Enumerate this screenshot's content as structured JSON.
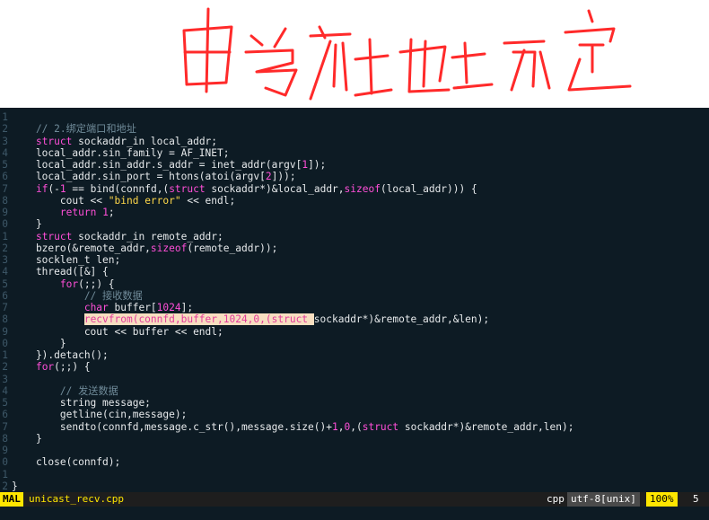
{
  "annotation": {
    "text": "由当前地址而定",
    "color": "#ff2a2a"
  },
  "editor": {
    "lines": [
      {
        "no": "1",
        "code": ""
      },
      {
        "no": "2",
        "code": "    // 2.绑定端口和地址"
      },
      {
        "no": "3",
        "code": "    struct sockaddr_in local_addr;"
      },
      {
        "no": "4",
        "code": "    local_addr.sin_family = AF_INET;"
      },
      {
        "no": "5",
        "code": "    local_addr.sin_addr.s_addr = inet_addr(argv[1]);"
      },
      {
        "no": "6",
        "code": "    local_addr.sin_port = htons(atoi(argv[2]));"
      },
      {
        "no": "7",
        "code": "    if(-1 == bind(connfd,(struct sockaddr*)&local_addr,sizeof(local_addr))) {"
      },
      {
        "no": "8",
        "code": "        cout << \"bind error\" << endl;"
      },
      {
        "no": "9",
        "code": "        return 1;"
      },
      {
        "no": "0",
        "code": "    }"
      },
      {
        "no": "1",
        "code": "    struct sockaddr_in remote_addr;"
      },
      {
        "no": "2",
        "code": "    bzero(&remote_addr,sizeof(remote_addr));"
      },
      {
        "no": "3",
        "code": "    socklen_t len;"
      },
      {
        "no": "4",
        "code": "    thread([&] {"
      },
      {
        "no": "5",
        "code": "        for(;;) {"
      },
      {
        "no": "6",
        "code": "            // 接收数据"
      },
      {
        "no": "7",
        "code": "            char buffer[1024];"
      },
      {
        "no": "8",
        "code": "            recvfrom(connfd,buffer,1024,0,(struct sockaddr*)&remote_addr,&len);"
      },
      {
        "no": "9",
        "code": "            cout << buffer << endl;"
      },
      {
        "no": "0",
        "code": "        }"
      },
      {
        "no": "1",
        "code": "    }).detach();"
      },
      {
        "no": "2",
        "code": "    for(;;) {"
      },
      {
        "no": "3",
        "code": ""
      },
      {
        "no": "4",
        "code": "        // 发送数据"
      },
      {
        "no": "5",
        "code": "        string message;"
      },
      {
        "no": "6",
        "code": "        getline(cin,message);"
      },
      {
        "no": "7",
        "code": "        sendto(connfd,message.c_str(),message.size()+1,0,(struct sockaddr*)&remote_addr,len);"
      },
      {
        "no": "8",
        "code": "    }"
      },
      {
        "no": "9",
        "code": ""
      },
      {
        "no": "0",
        "code": "    close(connfd);"
      },
      {
        "no": "1",
        "code": ""
      },
      {
        "no": "2",
        "code": "}"
      }
    ]
  },
  "statusbar": {
    "mode": "MAL",
    "filename": "unicast_recv.cpp",
    "filetype": "cpp",
    "encoding": "utf-8[unix]",
    "percent": "100%",
    "position": "5"
  }
}
